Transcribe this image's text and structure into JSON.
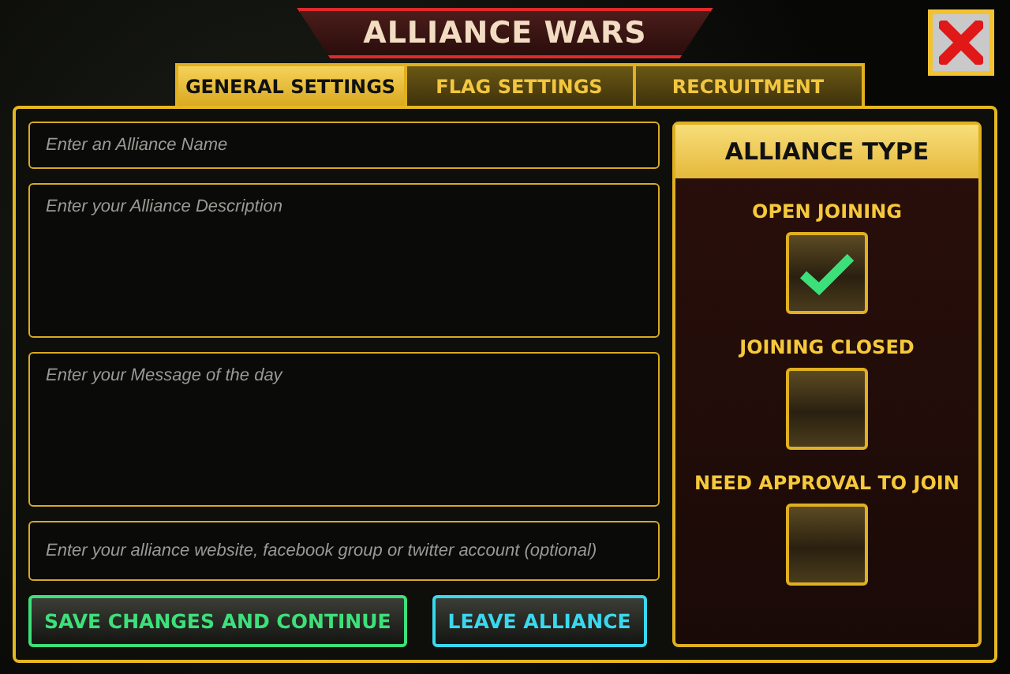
{
  "title": "ALLIANCE WARS",
  "tabs": [
    {
      "label": "GENERAL SETTINGS",
      "selected": true
    },
    {
      "label": "FLAG SETTINGS",
      "selected": false
    },
    {
      "label": "RECRUITMENT",
      "selected": false
    }
  ],
  "fields": [
    {
      "kind": "input",
      "placeholder": "Enter an Alliance Name"
    },
    {
      "kind": "textarea",
      "placeholder": "Enter your Alliance Description"
    },
    {
      "kind": "textarea",
      "placeholder": "Enter your Message of the day"
    },
    {
      "kind": "input",
      "placeholder": "Enter your alliance website, facebook group or twitter account (optional)"
    }
  ],
  "buttons": [
    {
      "label": "SAVE CHANGES AND CONTINUE",
      "kind": "confirm"
    },
    {
      "label": "LEAVE ALLIANCE",
      "kind": "exit"
    }
  ],
  "alliance_type": {
    "title": "ALLIANCE TYPE",
    "options": [
      {
        "label": "OPEN JOINING",
        "checked": true
      },
      {
        "label": "JOINING CLOSED",
        "checked": false
      },
      {
        "label": "NEED APPROVAL TO JOIN",
        "checked": false
      }
    ]
  }
}
